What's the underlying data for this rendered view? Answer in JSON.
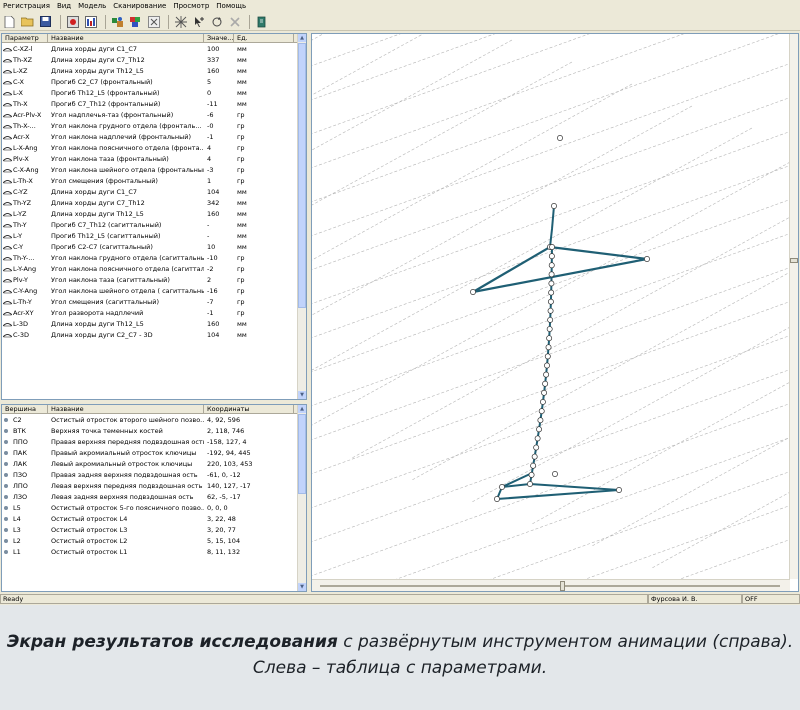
{
  "menu": [
    "Регистрация",
    "Вид",
    "Модель",
    "Сканирование",
    "Просмотр",
    "Помощь"
  ],
  "toolbar": {
    "icons": [
      "new-file-icon",
      "open-folder-icon",
      "save-icon",
      "record-icon",
      "chart-icon",
      "model-icon",
      "color-model-icon",
      "settings-icon",
      "grid-icon",
      "add-point-icon",
      "rotate-icon",
      "delete-icon",
      "export-icon"
    ]
  },
  "params": {
    "headers": [
      "Параметр",
      "Название",
      "Значе...",
      "Ед."
    ],
    "rows": [
      {
        "code": "C-XZ-l",
        "name": "Длина хорды дуги C1_C7",
        "value": "100",
        "unit": "мм"
      },
      {
        "code": "Th-XZ",
        "name": "Длина хорды дуги C7_Th12",
        "value": "337",
        "unit": "мм"
      },
      {
        "code": "L-XZ",
        "name": "Длина хорды дуги Th12_L5",
        "value": "160",
        "unit": "мм"
      },
      {
        "code": "C-X",
        "name": "Прогиб C2_C7 (фронтальный)",
        "value": "5",
        "unit": "мм"
      },
      {
        "code": "L-X",
        "name": "Прогиб Th12_L5 (фронтальный)",
        "value": "0",
        "unit": "мм"
      },
      {
        "code": "Th-X",
        "name": "Прогиб C7_Th12 (фронтальный)",
        "value": "-11",
        "unit": "мм"
      },
      {
        "code": "Acr-Plv-X",
        "name": "Угол надплечья-таз (фронтальный)",
        "value": "-6",
        "unit": "гр"
      },
      {
        "code": "Th-X-...",
        "name": "Угол наклона грудного отдела (фронталь...",
        "value": "-0",
        "unit": "гр"
      },
      {
        "code": "Acr-X",
        "name": "Угол наклона надплечий (фронтальный)",
        "value": "-1",
        "unit": "гр"
      },
      {
        "code": "L-X-Ang",
        "name": "Угол наклона поясничного отдела (фронта...",
        "value": "4",
        "unit": "гр"
      },
      {
        "code": "Plv-X",
        "name": "Угол наклона таза (фронтальный)",
        "value": "4",
        "unit": "гр"
      },
      {
        "code": "C-X-Ang",
        "name": "Угол наклона шейного отдела (фронтальный)",
        "value": "-3",
        "unit": "гр"
      },
      {
        "code": "L-Th-X",
        "name": "Угол смещения (фронтальный)",
        "value": "1",
        "unit": "гр"
      },
      {
        "code": "C-YZ",
        "name": "Длина хорды дуги C1_C7",
        "value": "104",
        "unit": "мм"
      },
      {
        "code": "Th-YZ",
        "name": "Длина хорды дуги C7_Th12",
        "value": "342",
        "unit": "мм"
      },
      {
        "code": "L-YZ",
        "name": "Длина хорды дуги Th12_L5",
        "value": "160",
        "unit": "мм"
      },
      {
        "code": "Th-Y",
        "name": "Прогиб C7_Th12 (сагиттальный)",
        "value": "-",
        "unit": "мм"
      },
      {
        "code": "L-Y",
        "name": "Прогиб Th12_L5 (сагиттальный)",
        "value": "-",
        "unit": "мм"
      },
      {
        "code": "C-Y",
        "name": "Прогиб C2-C7 (сагиттальный)",
        "value": "10",
        "unit": "мм"
      },
      {
        "code": "Th-Y-...",
        "name": "Угол наклона грудного отдела (сагиттальный)",
        "value": "-10",
        "unit": "гр"
      },
      {
        "code": "L-Y-Ang",
        "name": "Угол наклона поясничного отдела (сагитталь...",
        "value": "-2",
        "unit": "гр"
      },
      {
        "code": "Plv-Y",
        "name": "Угол наклона таза (сагиттальный)",
        "value": "2",
        "unit": "гр"
      },
      {
        "code": "C-Y-Ang",
        "name": "Угол наклона шейного отдела ( сагиттальный)",
        "value": "-16",
        "unit": "гр"
      },
      {
        "code": "L-Th-Y",
        "name": "Угол смещения (сагиттальный)",
        "value": "-7",
        "unit": "гр"
      },
      {
        "code": "Acr-XY",
        "name": "Угол разворота надплечий",
        "value": "-1",
        "unit": "гр"
      },
      {
        "code": "L-3D",
        "name": "Длина хорды дуги Th12_L5",
        "value": "160",
        "unit": "мм"
      },
      {
        "code": "C-3D",
        "name": "Длина хорды дуги C2_C7 - 3D",
        "value": "104",
        "unit": "мм"
      }
    ]
  },
  "vertices": {
    "headers": [
      "Вершина",
      "Название",
      "Координаты"
    ],
    "rows": [
      {
        "code": "C2",
        "name": "Остистый отросток второго шейного позво...",
        "coords": "4, 92, 596"
      },
      {
        "code": "ВТК",
        "name": "Верхняя точка теменных костей",
        "coords": "2, 118, 746"
      },
      {
        "code": "ППО",
        "name": "Правая верхняя передняя подвздошная ость",
        "coords": "-158, 127, 4"
      },
      {
        "code": "ПАК",
        "name": "Правый акромиальный отросток ключицы",
        "coords": "-192, 94, 445"
      },
      {
        "code": "ЛАК",
        "name": "Левый акромиальный отросток ключицы",
        "coords": "220, 103, 453"
      },
      {
        "code": "ПЗО",
        "name": "Правая задняя верхняя подвздошная ость",
        "coords": "-61, 0, -12"
      },
      {
        "code": "ЛПО",
        "name": "Левая верхняя передняя подвздошная ость",
        "coords": "140, 127, -17"
      },
      {
        "code": "ЛЗО",
        "name": "Левая задняя верхняя подвздошная ость",
        "coords": "62, -5, -17"
      },
      {
        "code": "L5",
        "name": "Остистый отросток 5-го поясничного позво...",
        "coords": "0, 0, 0"
      },
      {
        "code": "L4",
        "name": "Остистый отросток L4",
        "coords": "3, 22, 48"
      },
      {
        "code": "L3",
        "name": "Остистый отросток L3",
        "coords": "3, 20, 77"
      },
      {
        "code": "L2",
        "name": "Остистый отросток L2",
        "coords": "5, 15, 104"
      },
      {
        "code": "L1",
        "name": "Остистый отросток L1",
        "coords": "8, 11, 132"
      }
    ]
  },
  "status": {
    "ready": "Ready",
    "user": "Фурсова И. В.",
    "mode": "OFF"
  },
  "caption": {
    "emphasis": "Экран результатов исследования",
    "rest_line1": " с развёрнутым инструментом анимации (справа).",
    "line2": "Слева – таблица с параметрами."
  },
  "colors": {
    "skeleton": "#1f5f74",
    "grid": "#b5b5b5"
  }
}
